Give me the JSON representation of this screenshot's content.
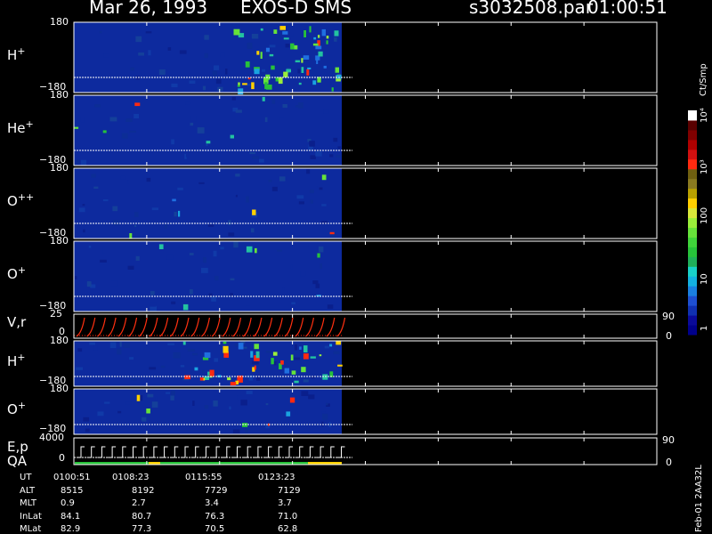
{
  "header": {
    "date": "Mar 26, 1993",
    "mission": "EXOS-D SMS",
    "file": "s3032508.par",
    "time": "01:00:51"
  },
  "panels": [
    {
      "name": "H",
      "sup": "+",
      "ytop": "180",
      "ybot": "−180"
    },
    {
      "name": "He",
      "sup": "+",
      "ytop": "180",
      "ybot": "−180"
    },
    {
      "name": "O",
      "sup": "++",
      "ytop": "180",
      "ybot": "−180"
    },
    {
      "name": "O",
      "sup": "+",
      "ytop": "180",
      "ybot": "−180"
    },
    {
      "name": "V,r",
      "sup": "",
      "ytop": "25",
      "ybot": "0",
      "rtop": "90",
      "rbot": "0"
    },
    {
      "name": "H",
      "sup": "+",
      "ytop": "180",
      "ybot": "−180"
    },
    {
      "name": "O",
      "sup": "+",
      "ytop": "180",
      "ybot": "−180"
    },
    {
      "name": "E,p",
      "sub2": "QA",
      "ytop": "4000",
      "ybot": "0",
      "rtop": "90",
      "rbot": "0"
    }
  ],
  "colorbar": {
    "unit": "Ct/Smp",
    "ticks": [
      "1",
      "10",
      "100",
      "10³",
      "10⁴"
    ],
    "colors": [
      "#00008b",
      "#0a0a9a",
      "#1030b0",
      "#1e4fd0",
      "#1a7fe0",
      "#13b0e0",
      "#18d0c8",
      "#1faf5a",
      "#27c23a",
      "#3fd33a",
      "#66e23a",
      "#9aee3a",
      "#d8e83a",
      "#ffd000",
      "#b8a000",
      "#8a7a20",
      "#706010",
      "#ff2a10",
      "#d01010",
      "#b00000",
      "#800000",
      "#5a0000",
      "#ffffff"
    ]
  },
  "footer": {
    "rows": [
      {
        "label": "UT",
        "values": [
          "0100:51",
          "0108:23",
          "0115:55",
          "0123:23"
        ]
      },
      {
        "label": "ALT",
        "values": [
          "8515",
          "8192",
          "7729",
          "7129"
        ]
      },
      {
        "label": "MLT",
        "values": [
          "0.9",
          "2.7",
          "3.4",
          "3.7"
        ]
      },
      {
        "label": "InLat",
        "values": [
          "84.1",
          "80.7",
          "76.3",
          "71.0"
        ]
      },
      {
        "label": "MLat",
        "values": [
          "82.9",
          "77.3",
          "70.5",
          "62.8"
        ]
      }
    ],
    "stamp": "Feb-01 2AA32L"
  },
  "chart_data": {
    "type": "heatmap",
    "title": "Mar 26, 1993 EXOS-D SMS",
    "x_ticks": [
      "0100:51",
      "0108:23",
      "0115:55",
      "0123:23"
    ],
    "panels": [
      "H+",
      "He+",
      "O++",
      "O+",
      "V,r",
      "H+",
      "O+",
      "E,p"
    ],
    "colorbar_ticks": [
      "1",
      "10",
      "100",
      "10³",
      "10⁴"
    ],
    "colorbar_unit": "Ct/Smp",
    "data_end_fraction": 0.5
  }
}
